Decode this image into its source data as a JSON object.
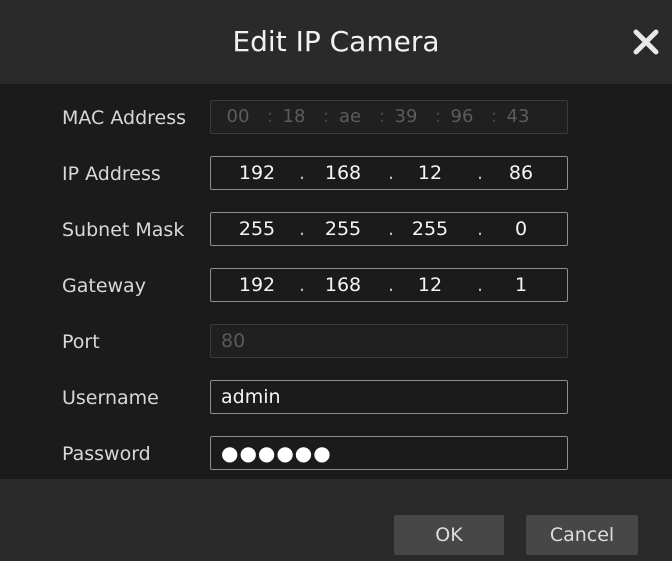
{
  "dialog": {
    "title": "Edit IP Camera",
    "close_icon": "close-icon"
  },
  "fields": {
    "mac": {
      "label": "MAC Address",
      "segments": [
        "00",
        "18",
        "ae",
        "39",
        "96",
        "43"
      ],
      "separator": ":",
      "disabled": true
    },
    "ip": {
      "label": "IP Address",
      "octets": [
        "192",
        "168",
        "12",
        "86"
      ],
      "separator": "."
    },
    "subnet": {
      "label": "Subnet Mask",
      "octets": [
        "255",
        "255",
        "255",
        "0"
      ],
      "separator": "."
    },
    "gateway": {
      "label": "Gateway",
      "octets": [
        "192",
        "168",
        "12",
        "1"
      ],
      "separator": "."
    },
    "port": {
      "label": "Port",
      "value": "80",
      "disabled": true
    },
    "username": {
      "label": "Username",
      "value": "admin"
    },
    "password": {
      "label": "Password",
      "masked_value": "●●●●●●"
    }
  },
  "buttons": {
    "ok_label": "OK",
    "cancel_label": "Cancel"
  },
  "colors": {
    "title_bar": "#2a2a2a",
    "body": "#1b1b1b",
    "footer": "#2a2a2a",
    "button": "#474747",
    "text": "#d8d8d8"
  }
}
